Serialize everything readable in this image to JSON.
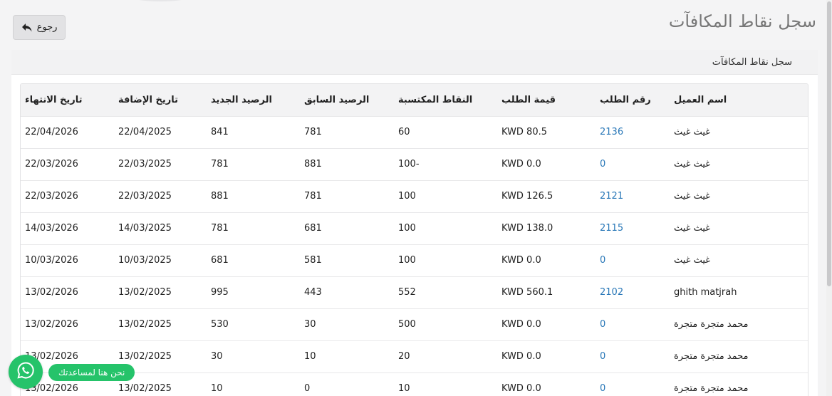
{
  "header": {
    "page_title": "سجل نقاط المكافآت",
    "back_label": "رجوع"
  },
  "card": {
    "title": "سجل نقاط المكافآت"
  },
  "table": {
    "columns": [
      "اسم العميل",
      "رقم الطلب",
      "قيمة الطلب",
      "النقاط المكتسبة",
      "الرصيد السابق",
      "الرصيد الجديد",
      "تاريخ الإضافة",
      "تاريخ الانتهاء"
    ],
    "rows": [
      {
        "customer": "غيث غيث",
        "order": "2136",
        "value": "KWD 80.5",
        "points": "60",
        "prev": "781",
        "new": "841",
        "added": "22/04/2025",
        "expires": "22/04/2026"
      },
      {
        "customer": "غيث غيث",
        "order": "0",
        "value": "KWD 0.0",
        "points": "100-",
        "prev": "881",
        "new": "781",
        "added": "22/03/2025",
        "expires": "22/03/2026"
      },
      {
        "customer": "غيث غيث",
        "order": "2121",
        "value": "KWD 126.5",
        "points": "100",
        "prev": "781",
        "new": "881",
        "added": "22/03/2025",
        "expires": "22/03/2026"
      },
      {
        "customer": "غيث غيث",
        "order": "2115",
        "value": "KWD 138.0",
        "points": "100",
        "prev": "681",
        "new": "781",
        "added": "14/03/2025",
        "expires": "14/03/2026"
      },
      {
        "customer": "غيث غيث",
        "order": "0",
        "value": "KWD 0.0",
        "points": "100",
        "prev": "581",
        "new": "681",
        "added": "10/03/2025",
        "expires": "10/03/2026"
      },
      {
        "customer": "ghith matjrah",
        "order": "2102",
        "value": "KWD 560.1",
        "points": "552",
        "prev": "443",
        "new": "995",
        "added": "13/02/2025",
        "expires": "13/02/2026"
      },
      {
        "customer": "محمد متجرة متجرة",
        "order": "0",
        "value": "KWD 0.0",
        "points": "500",
        "prev": "30",
        "new": "530",
        "added": "13/02/2025",
        "expires": "13/02/2026"
      },
      {
        "customer": "محمد متجرة متجرة",
        "order": "0",
        "value": "KWD 0.0",
        "points": "20",
        "prev": "10",
        "new": "30",
        "added": "13/02/2025",
        "expires": "13/02/2026"
      },
      {
        "customer": "محمد متجرة متجرة",
        "order": "0",
        "value": "KWD 0.0",
        "points": "10",
        "prev": "0",
        "new": "10",
        "added": "13/02/2025",
        "expires": "13/02/2026"
      }
    ]
  },
  "whatsapp": {
    "label": "نحن هنا لمساعدتك",
    "icon": "whatsapp-icon",
    "color": "#25c36a"
  },
  "colors": {
    "link": "#2a78b8",
    "title": "#777777"
  }
}
